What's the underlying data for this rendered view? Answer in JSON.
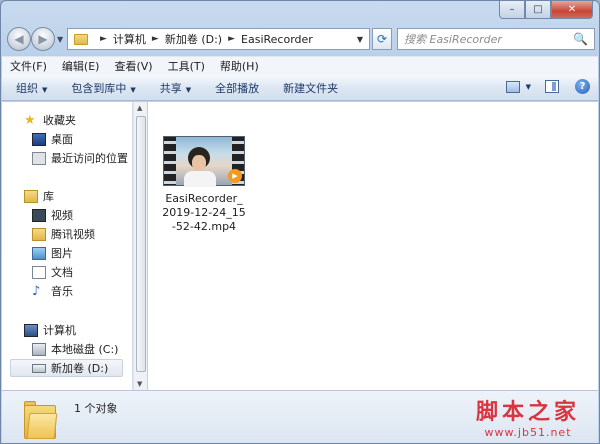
{
  "window": {
    "min_label": "–",
    "max_label": "□",
    "close_label": "✕"
  },
  "address": {
    "segments": [
      "计算机",
      "新加卷 (D:)",
      "EasiRecorder"
    ],
    "separator": "►",
    "dropdown": "▼"
  },
  "search": {
    "placeholder": "搜索 EasiRecorder",
    "icon": "🔍"
  },
  "menu": {
    "items": [
      "文件(F)",
      "编辑(E)",
      "查看(V)",
      "工具(T)",
      "帮助(H)"
    ]
  },
  "toolbar": {
    "organize": "组织",
    "include_library": "包含到库中",
    "share": "共享",
    "play_all": "全部播放",
    "new_folder": "新建文件夹",
    "arrow": "▼"
  },
  "nav": {
    "favorites": "收藏夹",
    "desktop": "桌面",
    "recent": "最近访问的位置",
    "library": "库",
    "videos": "视频",
    "tencent_video": "腾讯视频",
    "pictures": "图片",
    "documents": "文档",
    "music": "音乐",
    "computer": "计算机",
    "local_disk": "本地磁盘 (C:)",
    "new_volume": "新加卷 (D:)"
  },
  "files": [
    {
      "name": "EasiRecorder_2019-12-24_15-52-42.mp4",
      "type": "video"
    }
  ],
  "status": {
    "count_text": "1 个对象"
  },
  "watermark": {
    "line1": "脚本之家",
    "line2": "www.jb51.net"
  },
  "colors": {
    "accent": "#1e3a66",
    "watermark": "#d9353f",
    "play_badge": "#f39a1f"
  }
}
